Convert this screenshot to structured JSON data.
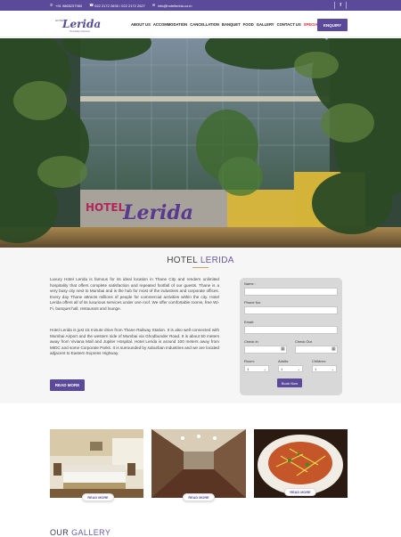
{
  "topbar": {
    "phone": "+91 9865237960",
    "landline": "022 2172 2636 / 022 2172 2627",
    "email": "info@hotellerida.co.in",
    "facebook": "f"
  },
  "logo": {
    "hotel": "HOTEL",
    "name": "Lerida",
    "tagline": "Hospitality Unlimited"
  },
  "menu": {
    "items": [
      "ABOUT US",
      "ACCOMMODATION",
      "CANCELLATION",
      "BANQUET",
      "FOOD",
      "GALLERY",
      "CONTACT US"
    ],
    "special": "SPECIAL OFFER"
  },
  "enquiry_label": "ENQUIRY",
  "hero": {
    "sign": "HOTEL Lerida"
  },
  "about": {
    "title_a": "HOTEL",
    "title_b": "LERIDA",
    "para1": "Luxury Hotel Lerida is famous for its ideal location in Thane City and renders unlimited hospitality that offers complete satisfaction and repeated footfall of our guests. Thane is a very busy city next to Mumbai and is the hub for most of the industries and corporate offices. Every day Thane attracts millions of people for commercial activities within the city. Hotel Lerida offers all of its luxurious services under one roof. We offer comfortable rooms, free Wi-Fi, banquet hall, restaurant and lounge.",
    "para2": "Hotel Lerida is just 15 minute drive from Thane Railway Station. It is also well connected with Mumbai Airport and the western side of Mumbai via Ghodbunder Road. It is about 50 meters away from Viviana Mall and Jupiter Hospital. Hotel Lerida is around 100 meters away from MIDC and some Corporate Parks. It is surrounded by suburban Industries and we are located adjacent to Eastern Express Highway.",
    "read_more": "READ MORE"
  },
  "form": {
    "name_label": "Name :",
    "phone_label": "Phone No:",
    "email_label": "Email:",
    "checkin_label": "Check In",
    "checkout_label": "Check Out",
    "room_label": "Room:",
    "adults_label": "Adults:",
    "children_label": "Children:",
    "room_value": "1",
    "adults_value": "1",
    "children_value": "1",
    "book_label": "Book Now"
  },
  "cards": [
    {
      "button": "READ MORE"
    },
    {
      "button": "READ MORE"
    },
    {
      "button": "READ MORE"
    }
  ],
  "gallery": {
    "title_a": "OUR",
    "title_b": "GALLERY"
  }
}
